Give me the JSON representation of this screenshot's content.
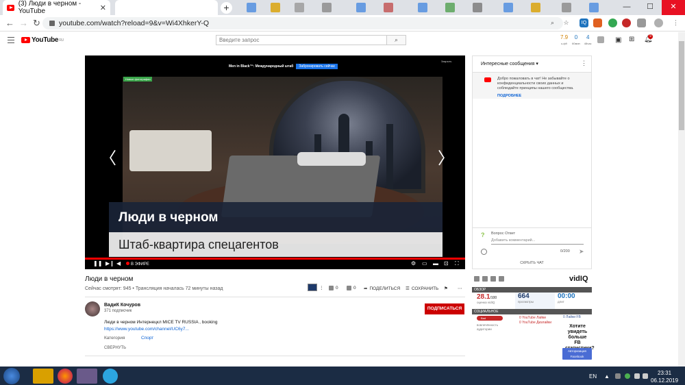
{
  "browser": {
    "tab_title": "(3) Люди в черном - YouTube",
    "url": "youtube.com/watch?reload=9&v=Wi4XhkerY-Q",
    "win_min": "—",
    "win_max": "☐",
    "win_close": "✕"
  },
  "youtube": {
    "logo_text": "YouTube",
    "logo_region": "RU",
    "search_placeholder": "Введите запрос",
    "stats": [
      {
        "value": "7.9",
        "label": "к-ф9"
      },
      {
        "value": "0",
        "label": "60мин"
      },
      {
        "value": "4",
        "label": "48час"
      }
    ],
    "notification_count": "9"
  },
  "player": {
    "ad_text": "Men in Black™: Международный штаб",
    "ad_button": "Забронировать сейчас",
    "close_label": "Закрыть",
    "photo_badge": "Новые фотографии",
    "overlay_title": "Люди в черном",
    "overlay_subtitle": "Штаб-квартира спецагентов",
    "live_label": "В ЭФИРЕ",
    "progress": 1.0
  },
  "video": {
    "title": "Люди в черном",
    "meta": "Сейчас смотрят: 945 • Трансляция началась 72 минуты назад",
    "likes": "0",
    "dislikes": "0",
    "share_label": "ПОДЕЛИТЬСЯ",
    "save_label": "СОХРАНИТЬ"
  },
  "channel": {
    "name": "ВадиК Кочуров",
    "subscribers": "371 подписчик",
    "subscribe_label": "ПОДПИСАТЬСЯ",
    "description": "Люди в черном Интернецкл MICE TV RUSSIA , booking",
    "link": "https://www.youtube.com/channel/UC6y7...",
    "category_label": "Категория",
    "category_value": "Спорт",
    "collapse_label": "СВЕРНУТЬ"
  },
  "chat": {
    "title": "Интересные сообщения",
    "welcome": "Добро пожаловать в чат! Не забывайте о конфиденциальности своих данных и соблюдайте принципы нашего сообщества.",
    "more_label": "ПОДРОБНЕЕ",
    "user": "Вопрос Ответ",
    "input_placeholder": "Добавить комментарий...",
    "char_count": "0/200",
    "hide_label": "СКРЫТЬ ЧАТ"
  },
  "vidiq": {
    "logo": "vidIQ",
    "overview_label": "ОБЗОР",
    "score": "28.1",
    "score_suffix": "/100",
    "score_label": "оценка vidIQ",
    "views": "664",
    "views_label": "просмотры",
    "time": "00:00",
    "time_label": "длит",
    "social_label": "СОЦИАЛЬНОЕ",
    "pill_label": "Bad",
    "engagement_label": "вовлечённость аудитории",
    "yt_likes": "0 YouTube Лайки",
    "yt_dislikes": "0 YouTube Дизлайки",
    "fb_likes": "0 Лайки FB",
    "fb_prompt": "Хотите увидеть больше FB статистики?",
    "fb_button": "Авторизация Facebook"
  },
  "taskbar": {
    "lang": "EN",
    "time": "23:31",
    "date": "06.12.2019"
  }
}
